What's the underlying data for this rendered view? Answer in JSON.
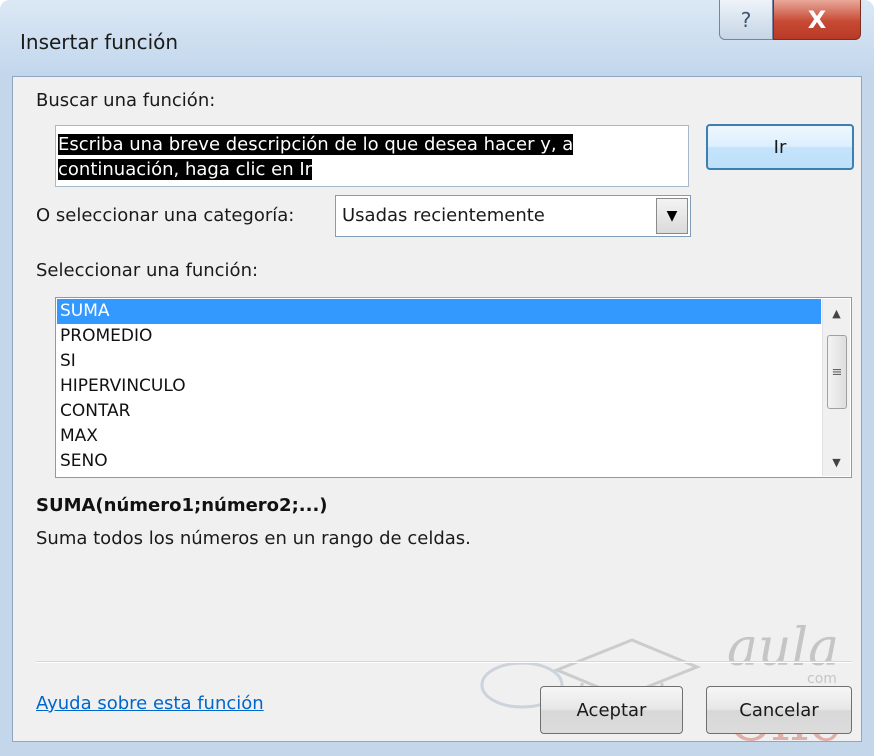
{
  "window": {
    "title": "Insertar función",
    "help_glyph": "?",
    "close_glyph": "X"
  },
  "search": {
    "label": "Buscar una función:",
    "value": "Escriba una breve descripción de lo que desea hacer y, a continuación, haga clic en Ir",
    "go_button": "Ir"
  },
  "category": {
    "label": "O seleccionar una categoría:",
    "selected": "Usadas recientemente"
  },
  "functions": {
    "label": "Seleccionar una función:",
    "items": [
      "SUMA",
      "PROMEDIO",
      "SI",
      "HIPERVINCULO",
      "CONTAR",
      "MAX",
      "SENO"
    ],
    "selected_index": 0
  },
  "details": {
    "syntax": "SUMA(número1;número2;...)",
    "description": "Suma todos los números en un rango de celdas."
  },
  "footer": {
    "help_link": "Ayuda sobre esta función",
    "ok_button": "Aceptar",
    "cancel_button": "Cancelar"
  },
  "watermark": {
    "brand_top": "aula",
    "brand_mid": "com",
    "brand_bottom": "Clic"
  },
  "colors": {
    "selection": "#3399ff",
    "link": "#0066cc",
    "close_button": "#c74a35"
  }
}
